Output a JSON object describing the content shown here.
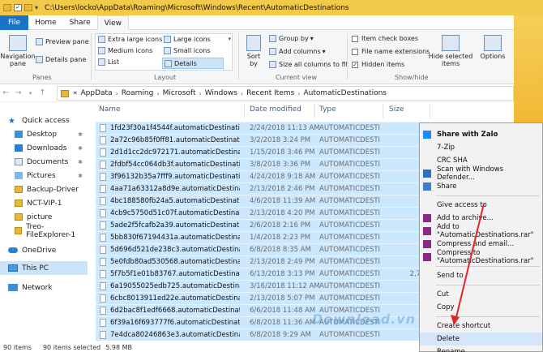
{
  "window": {
    "title": "C:\\Users\\locko\\AppData\\Roaming\\Microsoft\\Windows\\Recent\\AutomaticDestinations"
  },
  "ribbon_tabs": [
    "File",
    "Home",
    "Share",
    "View"
  ],
  "ribbon": {
    "panes": {
      "navigation_pane": "Navigation\npane",
      "preview_pane": "Preview pane",
      "details_pane": "Details pane",
      "label": "Panes"
    },
    "layout": {
      "items": [
        "Extra large icons",
        "Large icons",
        "Medium icons",
        "Small icons",
        "List",
        "Details"
      ],
      "selected": "Details",
      "label": "Layout"
    },
    "current_view": {
      "sort_by": "Sort\nby",
      "group_by": "Group by",
      "add_columns": "Add columns",
      "size_all": "Size all columns to fit",
      "label": "Current view"
    },
    "show_hide": {
      "item_check_boxes": "Item check boxes",
      "file_name_extensions": "File name extensions",
      "hidden_items": "Hidden items",
      "hide_selected": "Hide selected\nitems",
      "options": "Options",
      "label": "Show/hide"
    }
  },
  "address": {
    "crumbs": [
      "«",
      "AppData",
      "Roaming",
      "Microsoft",
      "Windows",
      "Recent Items",
      "AutomaticDestinations"
    ]
  },
  "nav": {
    "items": [
      {
        "label": "Quick access",
        "icon": "star-icon"
      },
      {
        "label": "Desktop",
        "icon": "desktop-icon"
      },
      {
        "label": "Downloads",
        "icon": "download-icon"
      },
      {
        "label": "Documents",
        "icon": "documents-icon"
      },
      {
        "label": "Pictures",
        "icon": "pictures-icon"
      },
      {
        "label": "Backup-Driver",
        "icon": "folder-icon"
      },
      {
        "label": "NCT-VIP-1",
        "icon": "folder-icon"
      },
      {
        "label": "picture",
        "icon": "folder-icon"
      },
      {
        "label": "Treo-FileExplorer-1",
        "icon": "folder-icon"
      },
      {
        "label": "OneDrive",
        "icon": "onedrive-icon"
      },
      {
        "label": "This PC",
        "icon": "computer-icon"
      },
      {
        "label": "Network",
        "icon": "network-icon"
      }
    ]
  },
  "columns": {
    "name": "Name",
    "date": "Date modified",
    "type": "Type",
    "size": "Size"
  },
  "files": [
    {
      "name": "1fd23f30a1f4544f.automaticDestinations-",
      "date": "2/24/2018 11:13 AM",
      "type": "AUTOMATICDESTI...",
      "size": "3"
    },
    {
      "name": "2a72c96b85f0ff81.automaticDestinations-",
      "date": "3/2/2018 3:24 PM",
      "type": "AUTOMATICDESTI...",
      "size": "3"
    },
    {
      "name": "2d1d1cc2dc972171.automaticDestination...",
      "date": "1/15/2018 3:46 PM",
      "type": "AUTOMATICDESTI...",
      "size": "3"
    },
    {
      "name": "2fdbf54cc064db3f.automaticDestinations-",
      "date": "3/8/2018 3:36 PM",
      "type": "AUTOMATICDESTI...",
      "size": "1"
    },
    {
      "name": "3f96132b35a7fff9.automaticDestinations-",
      "date": "4/24/2018 9:18 AM",
      "type": "AUTOMATICDESTI...",
      "size": "3"
    },
    {
      "name": "4aa71a63312a8d9e.automaticDestination...",
      "date": "2/13/2018 2:46 PM",
      "type": "AUTOMATICDESTI...",
      "size": "1"
    },
    {
      "name": "4bc188580fb24a5.automaticDestination...",
      "date": "4/6/2018 11:39 AM",
      "type": "AUTOMATICDESTI...",
      "size": ""
    },
    {
      "name": "4cb9c5750d51c07f.automaticDestination...",
      "date": "2/13/2018 4:20 PM",
      "type": "AUTOMATICDESTI...",
      "size": ""
    },
    {
      "name": "5ade2f5fcafb2a39.automaticDestinations",
      "date": "2/6/2018 2:16 PM",
      "type": "AUTOMATICDESTI...",
      "size": ""
    },
    {
      "name": "5bb830f67194431a.automaticDestination...",
      "date": "1/4/2018 2:23 PM",
      "type": "AUTOMATICDESTI...",
      "size": ""
    },
    {
      "name": "5d696d521de238c3.automaticDestination...",
      "date": "6/8/2018 8:35 AM",
      "type": "AUTOMATICDESTI...",
      "size": ""
    },
    {
      "name": "5e0fdb80ad530568.automaticDestination...",
      "date": "2/13/2018 2:49 PM",
      "type": "AUTOMATICDESTI...",
      "size": ""
    },
    {
      "name": "5f7b5f1e01b83767.automaticDestinations",
      "date": "6/13/2018 3:13 PM",
      "type": "AUTOMATICDESTI...",
      "size": "2,720"
    },
    {
      "name": "6a19055025edb725.automaticDestination...",
      "date": "3/16/2018 11:12 AM",
      "type": "AUTOMATICDESTI...",
      "size": ""
    },
    {
      "name": "6cbc8013911ed22e.automaticDestination...",
      "date": "2/13/2018 5:07 PM",
      "type": "AUTOMATICDESTI...",
      "size": ""
    },
    {
      "name": "6d2bac8f1edf6668.automaticDestinations",
      "date": "6/6/2018 11:48 AM",
      "type": "AUTOMATICDESTI...",
      "size": ""
    },
    {
      "name": "6f39a16f693777f6.automaticDestinations",
      "date": "6/8/2018 11:36 AM",
      "type": "AUTOMATICDESTI...",
      "size": ""
    },
    {
      "name": "7e4dca80246863e3.automaticDestination...",
      "date": "6/8/2018 9:29 AM",
      "type": "AUTOMATICDESTI...",
      "size": ""
    }
  ],
  "status": {
    "count": "90 items",
    "selected": "90 items selected",
    "size": "5.98 MB"
  },
  "context_menu": [
    {
      "label": "Share with Zalo",
      "bold": true,
      "icon": "zalo-icon"
    },
    {
      "label": "7-Zip",
      "icon": ""
    },
    {
      "label": "CRC SHA",
      "icon": ""
    },
    {
      "label": "Scan with Windows Defender...",
      "icon": "defender-icon"
    },
    {
      "label": "Share",
      "icon": "share-icon"
    },
    {
      "sep": true
    },
    {
      "label": "Give access to",
      "icon": ""
    },
    {
      "label": "Add to archive...",
      "icon": "winrar-icon"
    },
    {
      "label": "Add to \"AutomaticDestinations.rar\"",
      "icon": "winrar-icon"
    },
    {
      "label": "Compress and email...",
      "icon": "winrar-icon"
    },
    {
      "label": "Compress to \"AutomaticDestinations.rar\"",
      "icon": "winrar-icon"
    },
    {
      "sep": true
    },
    {
      "label": "Send to",
      "icon": ""
    },
    {
      "sep": true
    },
    {
      "label": "Cut",
      "icon": ""
    },
    {
      "label": "Copy",
      "icon": ""
    },
    {
      "sep": true
    },
    {
      "label": "Create shortcut",
      "icon": ""
    },
    {
      "label": "Delete",
      "icon": "",
      "highlight": true
    },
    {
      "label": "Rename",
      "icon": ""
    }
  ],
  "watermark": "Download.vn",
  "colors": {
    "selection": "#cce8ff",
    "file_tab": "#1a73c8",
    "titlebar": "#f3c94a",
    "arrow": "#e0262b"
  }
}
